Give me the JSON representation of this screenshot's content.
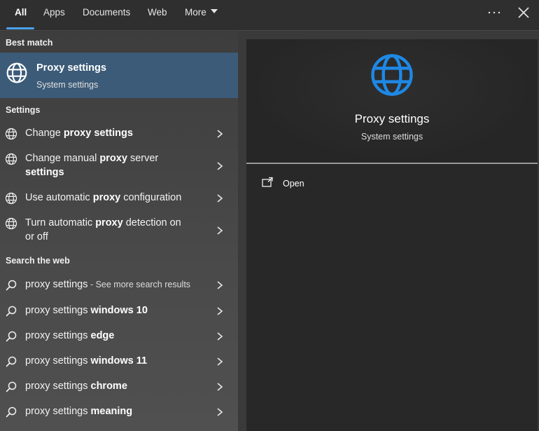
{
  "tabs": [
    {
      "label": "All",
      "active": true
    },
    {
      "label": "Apps"
    },
    {
      "label": "Documents"
    },
    {
      "label": "Web"
    },
    {
      "label": "More"
    }
  ],
  "top_icons": [
    "more-options-icon",
    "close-icon"
  ],
  "best_match": {
    "header": "Best match",
    "title": "Proxy settings",
    "subtitle": "System settings",
    "icon": "globe-icon"
  },
  "settings": {
    "header": "Settings",
    "items": [
      {
        "pre": "Change ",
        "bold": "proxy settings",
        "post": ""
      },
      {
        "pre": "Change manual ",
        "bold": "proxy",
        "post": " server",
        "line2_bold": "settings"
      },
      {
        "pre": "Use automatic ",
        "bold": "proxy",
        "post": " configuration"
      },
      {
        "pre": "Turn automatic ",
        "bold": "proxy",
        "post": " detection on",
        "line2": "or off"
      }
    ]
  },
  "web": {
    "header": "Search the web",
    "items": [
      {
        "pre": "proxy settings",
        "bold": "",
        "small": " - See more search results"
      },
      {
        "pre": "proxy settings ",
        "bold": "windows 10"
      },
      {
        "pre": "proxy settings ",
        "bold": "edge"
      },
      {
        "pre": "proxy settings ",
        "bold": "windows 11"
      },
      {
        "pre": "proxy settings ",
        "bold": "chrome"
      },
      {
        "pre": "proxy settings ",
        "bold": "meaning"
      }
    ]
  },
  "preview": {
    "title": "Proxy settings",
    "subtitle": "System settings",
    "actions": [
      {
        "label": "Open",
        "icon": "open-external-icon"
      }
    ]
  },
  "colors": {
    "accent": "#4ca3f2",
    "selected": "#3c5b78",
    "globe_blue": "#1e88e5"
  }
}
